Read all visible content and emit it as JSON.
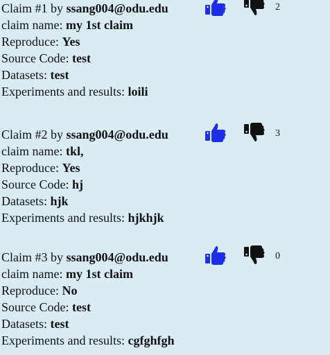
{
  "claims": [
    {
      "title": "Claim #1",
      "by": "by",
      "email": "ssang004@odu.edu",
      "count": "2",
      "fields": [
        {
          "label": "claim name: ",
          "value": "my 1st claim"
        },
        {
          "label": "Reproduce: ",
          "value": "Yes"
        },
        {
          "label": "Source Code: ",
          "value": "test"
        },
        {
          "label": "Datasets: ",
          "value": "test"
        },
        {
          "label": "Experiments and results: ",
          "value": "loili"
        }
      ]
    },
    {
      "title": "Claim #2",
      "by": "by",
      "email": "ssang004@odu.edu",
      "count": "3",
      "fields": [
        {
          "label": "claim name: ",
          "value": "tkl,"
        },
        {
          "label": "Reproduce: ",
          "value": "Yes"
        },
        {
          "label": "Source Code: ",
          "value": "hj"
        },
        {
          "label": "Datasets: ",
          "value": "hjk"
        },
        {
          "label": "Experiments and results: ",
          "value": "hjkhjk"
        }
      ]
    },
    {
      "title": "Claim #3",
      "by": "by",
      "email": "ssang004@odu.edu",
      "count": "0",
      "fields": [
        {
          "label": "claim name: ",
          "value": "my 1st claim"
        },
        {
          "label": "Reproduce: ",
          "value": "No"
        },
        {
          "label": "Source Code: ",
          "value": "test"
        },
        {
          "label": "Datasets: ",
          "value": "test"
        },
        {
          "label": "Experiments and results: ",
          "value": "cgfghfgh"
        }
      ]
    }
  ],
  "icons": {
    "like": "thumbs-up-icon",
    "dislike": "thumbs-down-icon"
  },
  "colors": {
    "background": "#d9ecf4",
    "like": "#1a2fe6",
    "dislike": "#111111"
  }
}
